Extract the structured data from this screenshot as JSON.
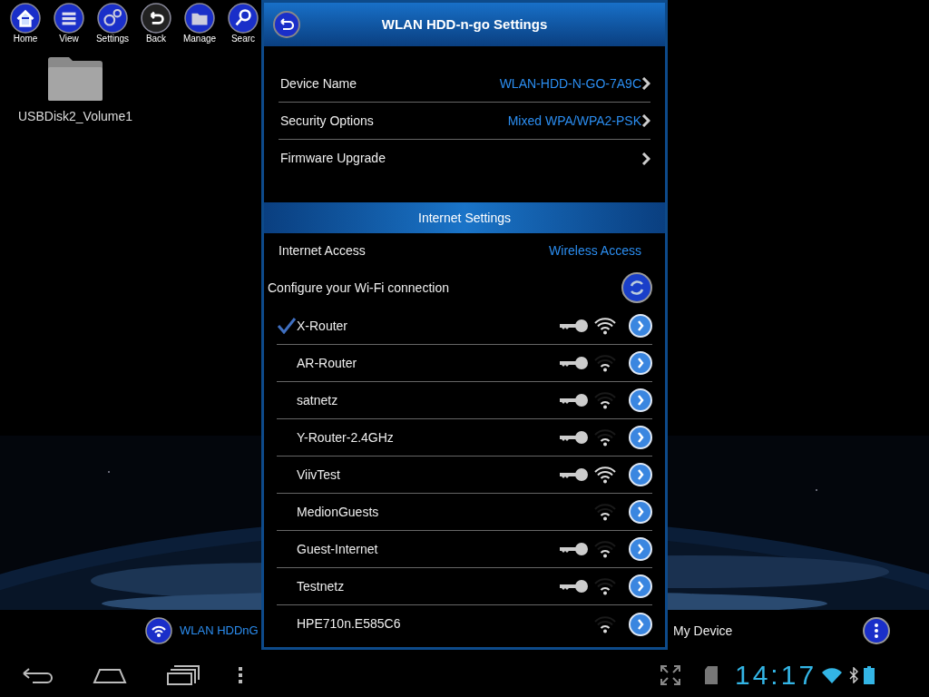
{
  "toolbar": [
    {
      "label": "Home"
    },
    {
      "label": "View"
    },
    {
      "label": "Settings"
    },
    {
      "label": "Back"
    },
    {
      "label": "Manage"
    },
    {
      "label": "Searc"
    }
  ],
  "desktop": {
    "items": [
      {
        "label": "USBDisk2_Volume1"
      }
    ]
  },
  "app_bar": {
    "left": "WLAN HDDnG",
    "right": "My Device"
  },
  "dialog": {
    "title": "WLAN HDD-n-go Settings",
    "settings": [
      {
        "label": "Device Name",
        "value": "WLAN-HDD-N-GO-7A9C"
      },
      {
        "label": "Security Options",
        "value": "Mixed WPA/WPA2-PSK"
      },
      {
        "label": "Firmware Upgrade"
      }
    ],
    "section": "Internet Settings",
    "internet_access": {
      "label": "Internet Access",
      "value": "Wireless Access"
    },
    "wifi_heading": "Configure your Wi-Fi connection",
    "networks": [
      {
        "name": "X-Router",
        "selected": true,
        "secured": true,
        "kind": "strong"
      },
      {
        "name": "AR-Router",
        "selected": false,
        "secured": true,
        "kind": "weak"
      },
      {
        "name": "satnetz",
        "selected": false,
        "secured": true,
        "kind": "weak"
      },
      {
        "name": "Y-Router-2.4GHz",
        "selected": false,
        "secured": true,
        "kind": "weak"
      },
      {
        "name": "ViivTest",
        "selected": false,
        "secured": true,
        "kind": "strong"
      },
      {
        "name": "MedionGuests",
        "selected": false,
        "secured": false,
        "kind": "weak"
      },
      {
        "name": "Guest-Internet",
        "selected": false,
        "secured": true,
        "kind": "weak"
      },
      {
        "name": "Testnetz",
        "selected": false,
        "secured": true,
        "kind": "weak"
      },
      {
        "name": "HPE710n.E585C6",
        "selected": false,
        "secured": false,
        "kind": "weak"
      }
    ]
  },
  "status_bar": {
    "time": "14:17"
  }
}
